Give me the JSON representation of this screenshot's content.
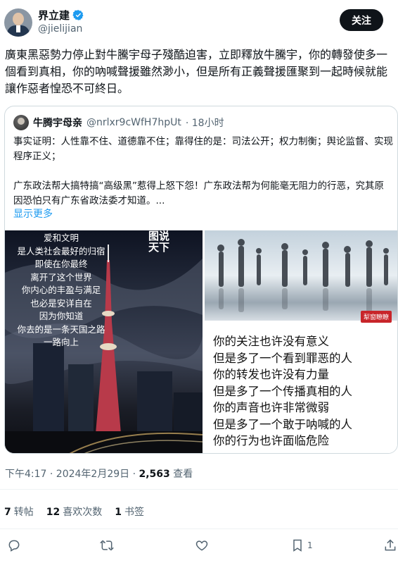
{
  "author": {
    "display_name": "界立建",
    "handle": "@jielijian",
    "follow_label": "关注"
  },
  "tweet": {
    "text": "廣東黑惡勢力停止對牛騰宇母子殘酷迫害，立即釋放牛騰宇，你的轉發使多一個看到真相，你的吶喊聲援雖然渺小，但是所有正義聲援匯聚到一起時候就能讓作惡者惶恐不可終日。"
  },
  "quote": {
    "display_name": "牛腾宇母亲",
    "handle": "@nrlxr9cWfH7hpUt",
    "time": "· 18小时",
    "paragraph1": "事实证明：人性靠不住、道德靠不住；靠得住的是：司法公开；权力制衡；舆论监督、实现程序正义；",
    "paragraph2": "广东政法帮大搞特搞“高级黑”惹得上怒下怨！广东政法帮为何能毫无阻力的行恶，究其原因恐怕只有广东省政法委才知道。...",
    "show_more": "显示更多",
    "image_left": {
      "poem_lines": [
        "爱和文明",
        "是人类社会最好的归宿",
        "即使在你最终",
        "离开了这个世界",
        "你内心的丰盈与满足",
        "也必是安详自在",
        "因为你知道",
        "你去的是一条天国之路",
        "一路向上"
      ],
      "stamp_line1": "图说",
      "stamp_line2": "天下"
    },
    "image_right": {
      "stamp": "犁窗瞭瞭",
      "poem_lines": [
        "你的关注也许没有意义",
        "但是多了一个看到罪恶的人",
        "你的转发也许没有力量",
        "但是多了一个传播真相的人",
        "你的声音也许非常微弱",
        "但是多了一个敢于呐喊的人",
        "你的行为也许面临危险"
      ]
    }
  },
  "meta": {
    "time": "下午4:17 · 2024年2月29日 · ",
    "views_count": "2,563",
    "views_label": " 查看"
  },
  "stats": {
    "retweets_count": "7",
    "retweets_label": "转帖",
    "quotes_count": "12",
    "quotes_label": "喜欢次数",
    "bookmarks_count": "1",
    "bookmarks_label": "书签"
  },
  "actions": {
    "bookmark_count": "1"
  },
  "colors": {
    "accent": "#1d9bf0",
    "text": "#0f1419",
    "muted": "#536471",
    "follow_bg": "#0f1419"
  }
}
